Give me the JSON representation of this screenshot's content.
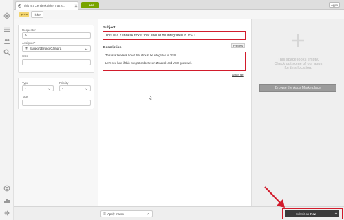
{
  "topbar": {
    "tab_title": "This is a Zendesk ticket that s...",
    "add_label": "+ add",
    "apps_label": "Apps"
  },
  "crumbbar": {
    "badge_label": "new",
    "ticket_label": "Ticket"
  },
  "properties": {
    "requester_label": "Requester",
    "requester_value": "A",
    "assignee_label": "Assignee*",
    "assignee_value": "Support/Bruno Câmara",
    "ccs_label": "CCs",
    "type_label": "Type",
    "type_value": "-",
    "priority_label": "Priority",
    "priority_value": "-",
    "tags_label": "Tags"
  },
  "ticket": {
    "subject_label": "Subject",
    "subject_value": "This is a Zendesk ticket that should be integrated in VSO",
    "preview_label": "Preview",
    "description_label": "Description",
    "description_line1": "This is a Zendesk ticket that should be integrated in VSO",
    "description_line2": "Let's see how if this integration between Zendesk and VSO goes well.",
    "attach_label": "Attach file"
  },
  "apps_panel": {
    "empty_text_1": "This space looks empty.",
    "empty_text_2": "Check out some of our apps",
    "empty_text_3": "for this location.",
    "browse_label": "Browse the Apps Marketplace"
  },
  "bottombar": {
    "macro_label": "Apply macro",
    "submit_prefix": "Submit as",
    "submit_status": "New"
  },
  "colors": {
    "highlight_red": "#d21c2c",
    "add_green": "#78a300",
    "new_badge_yellow": "#f3d46f",
    "submit_dark": "#3b3b3b"
  }
}
